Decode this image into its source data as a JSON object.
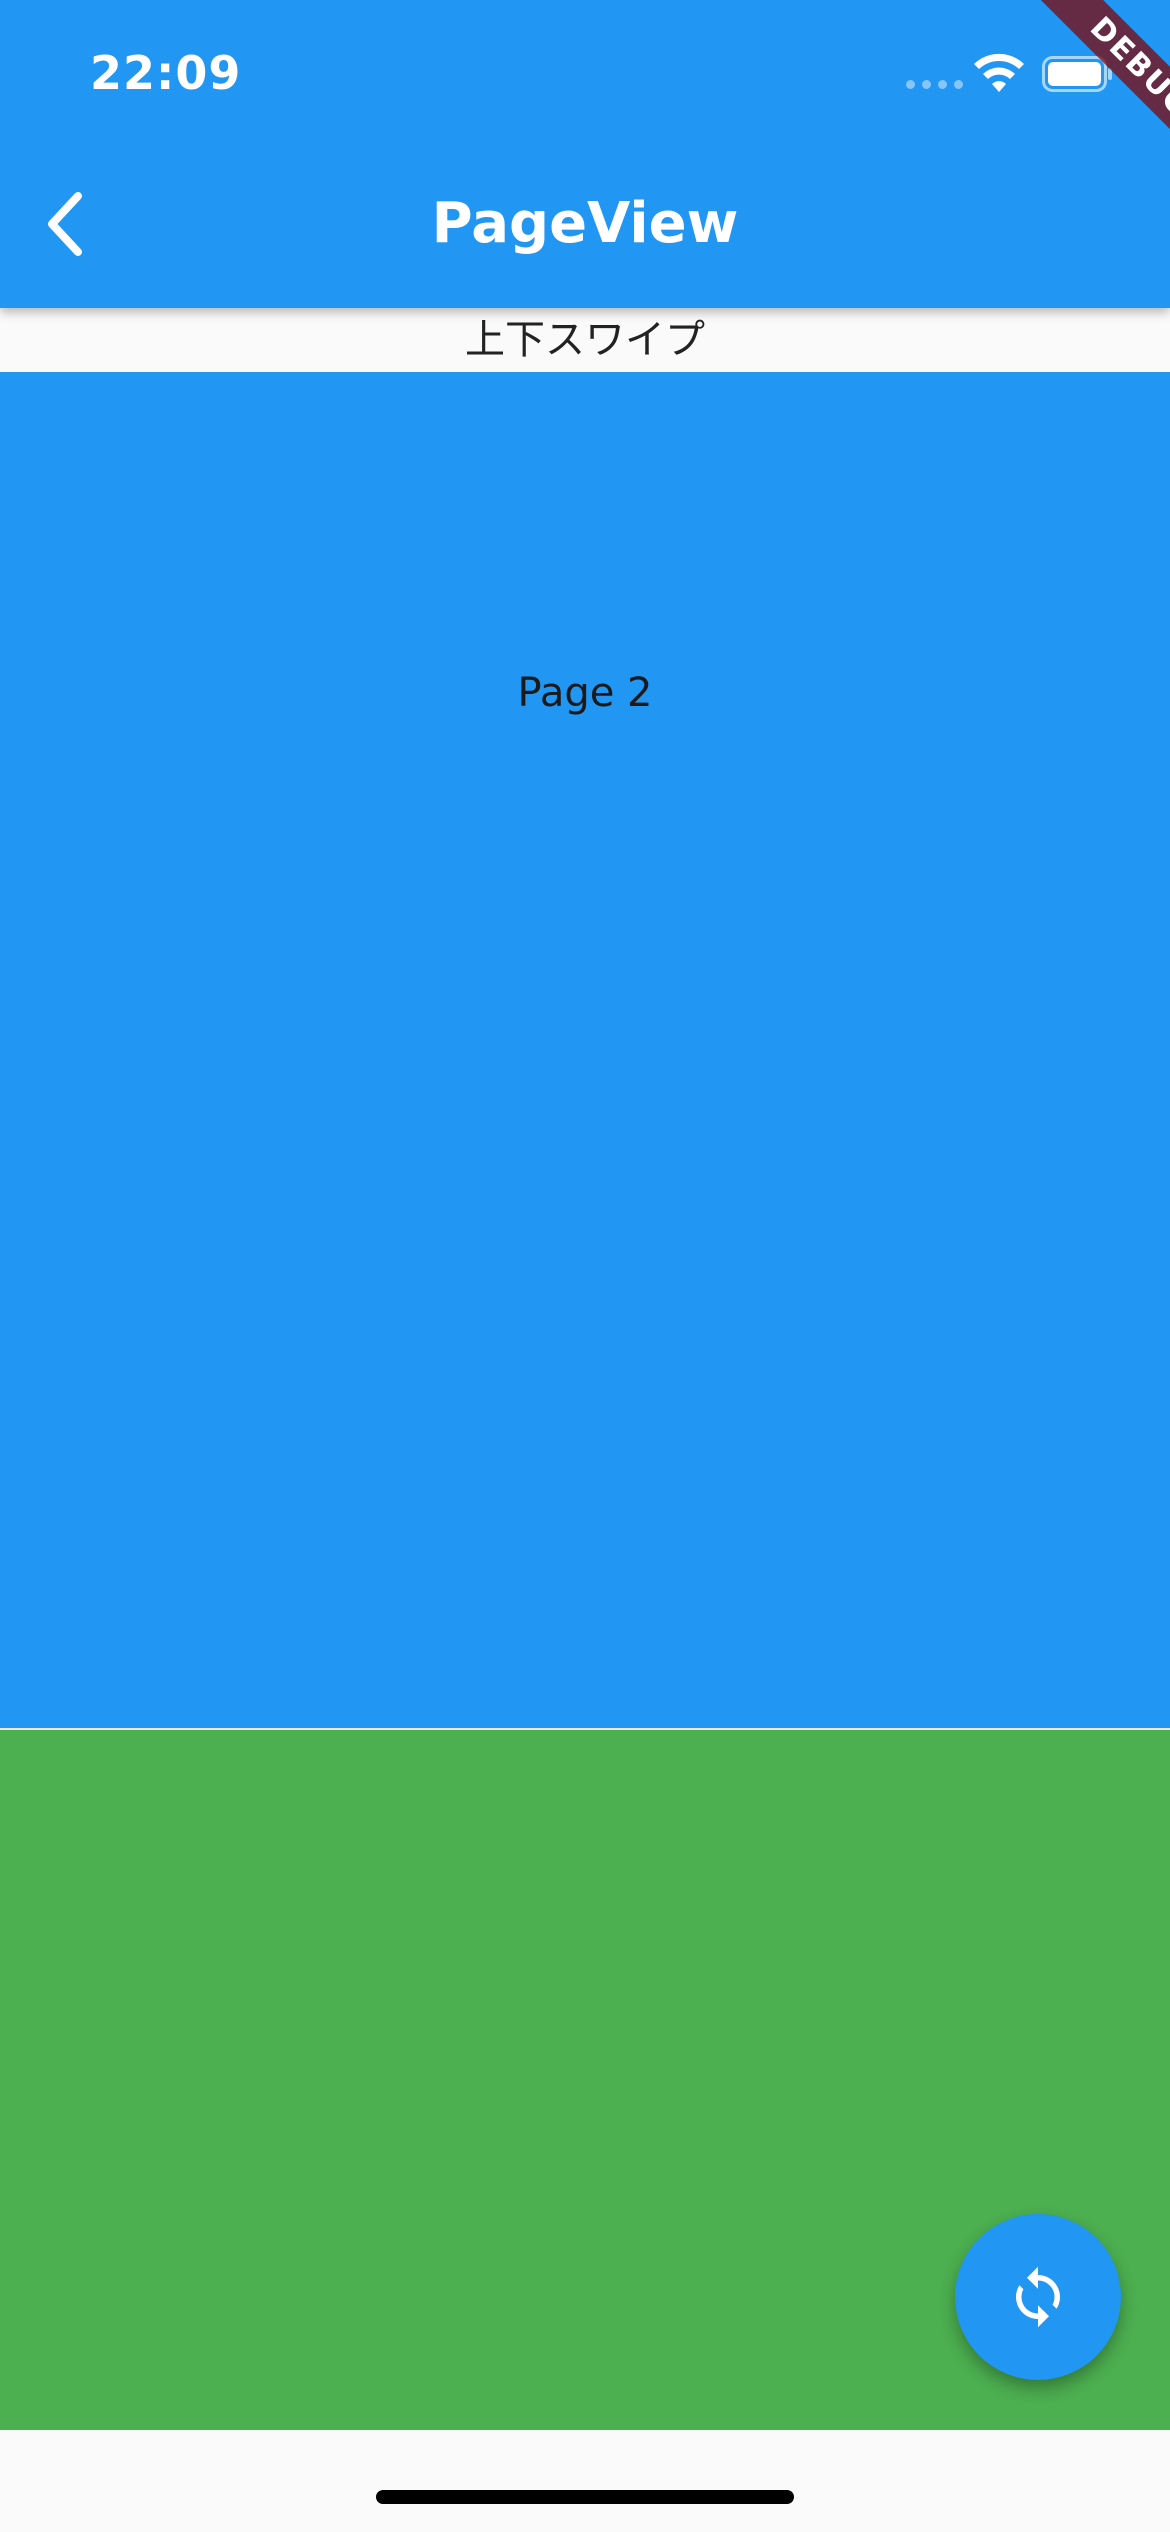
{
  "status_bar": {
    "time": "22:09",
    "icons": [
      "signal-dots-icon",
      "wifi-icon",
      "battery-icon"
    ]
  },
  "app_bar": {
    "title": "PageView",
    "back_icon": "chevron-left-icon",
    "color": "#2196f3"
  },
  "debug_banner": {
    "label": "DEBUG"
  },
  "swipe_label": "上下スワイプ",
  "pages": [
    {
      "label": "Page 2",
      "color": "#2196f3"
    },
    {
      "label": "",
      "color": "#4caf50"
    }
  ],
  "fab": {
    "icon": "sync-icon",
    "color": "#2196f3"
  }
}
